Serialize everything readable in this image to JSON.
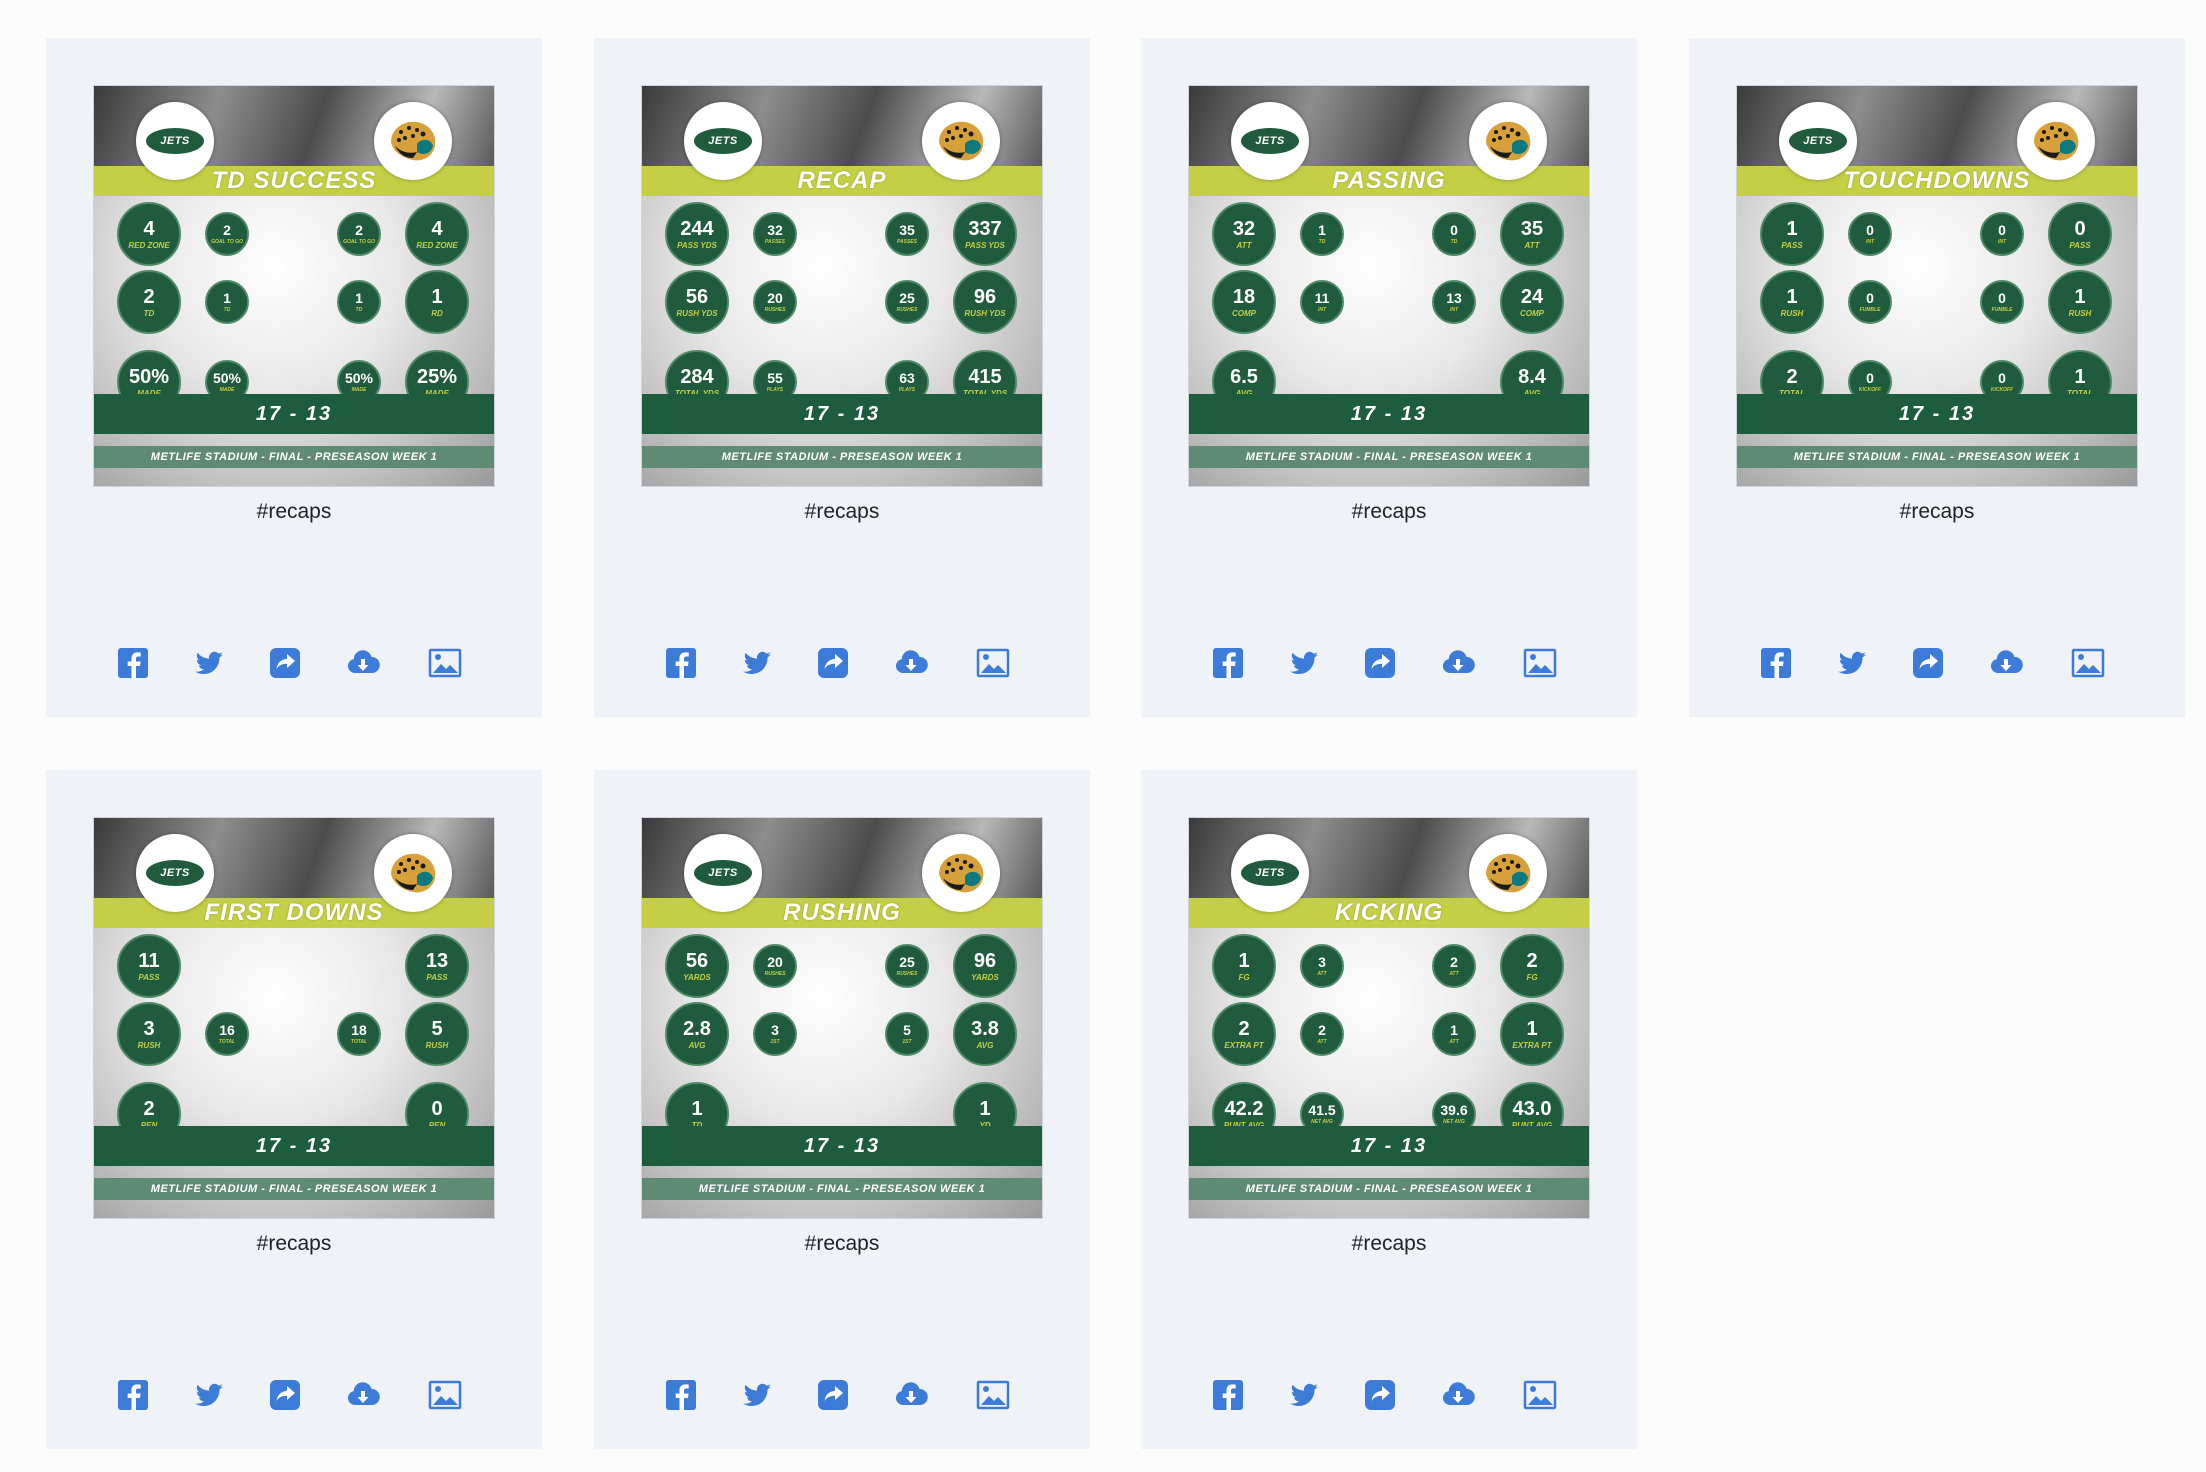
{
  "score": "17 - 13",
  "caption_tag": "#recaps",
  "colors": {
    "jets_green": "#1d5c3c",
    "accent_lime": "#c5cf45",
    "action_blue": "#3d7bd9",
    "card_bg": "#eff2f6"
  },
  "jets_logo_text": "JETS",
  "share_icons": [
    "facebook-icon",
    "twitter-icon",
    "share-icon",
    "download-cloud-icon",
    "image-icon"
  ],
  "cards": [
    {
      "title": "TD SUCCESS",
      "footer": "METLIFE STADIUM - FINAL - PRESEASON WEEK 1",
      "stats": [
        {
          "v": "4",
          "l": "RED ZONE"
        },
        {
          "v": "2",
          "l": "GOAL TO GO"
        },
        {
          "v": "2",
          "l": "GOAL TO GO"
        },
        {
          "v": "4",
          "l": "RED ZONE"
        },
        {
          "v": "2",
          "l": "TD"
        },
        {
          "v": "1",
          "l": "TD"
        },
        {
          "v": "1",
          "l": "TD"
        },
        {
          "v": "1",
          "l": "RD"
        },
        {
          "v": "50%",
          "l": "MADE"
        },
        {
          "v": "50%",
          "l": "MADE"
        },
        {
          "v": "50%",
          "l": "MADE"
        },
        {
          "v": "25%",
          "l": "MADE"
        }
      ]
    },
    {
      "title": "RECAP",
      "footer": "METLIFE STADIUM - PRESEASON WEEK 1",
      "stats": [
        {
          "v": "244",
          "l": "PASS YDS"
        },
        {
          "v": "32",
          "l": "PASSES"
        },
        {
          "v": "35",
          "l": "PASSES"
        },
        {
          "v": "337",
          "l": "PASS YDS"
        },
        {
          "v": "56",
          "l": "RUSH YDS"
        },
        {
          "v": "20",
          "l": "RUSHES"
        },
        {
          "v": "25",
          "l": "RUSHES"
        },
        {
          "v": "96",
          "l": "RUSH YDS"
        },
        {
          "v": "284",
          "l": "TOTAL YDS"
        },
        {
          "v": "55",
          "l": "PLAYS"
        },
        {
          "v": "63",
          "l": "PLAYS"
        },
        {
          "v": "415",
          "l": "TOTAL YDS"
        }
      ]
    },
    {
      "title": "PASSING",
      "footer": "METLIFE STADIUM - FINAL - PRESEASON WEEK 1",
      "stats": [
        {
          "v": "32",
          "l": "ATT"
        },
        {
          "v": "1",
          "l": "TD"
        },
        {
          "v": "0",
          "l": "TD"
        },
        {
          "v": "35",
          "l": "ATT"
        },
        {
          "v": "18",
          "l": "COMP"
        },
        {
          "v": "11",
          "l": "INT"
        },
        {
          "v": "13",
          "l": "INT"
        },
        {
          "v": "24",
          "l": "COMP"
        },
        {
          "v": "6.5",
          "l": "AVG"
        },
        {
          "v": "",
          "l": ""
        },
        {
          "v": "",
          "l": ""
        },
        {
          "v": "8.4",
          "l": "AVG"
        }
      ]
    },
    {
      "title": "TOUCHDOWNS",
      "footer": "METLIFE STADIUM - FINAL - PRESEASON WEEK 1",
      "stats": [
        {
          "v": "1",
          "l": "PASS"
        },
        {
          "v": "0",
          "l": "INT"
        },
        {
          "v": "0",
          "l": "INT"
        },
        {
          "v": "0",
          "l": "PASS"
        },
        {
          "v": "1",
          "l": "RUSH"
        },
        {
          "v": "0",
          "l": "FUMBLE"
        },
        {
          "v": "0",
          "l": "FUMBLE"
        },
        {
          "v": "1",
          "l": "RUSH"
        },
        {
          "v": "2",
          "l": "TOTAL"
        },
        {
          "v": "0",
          "l": "KICKOFF"
        },
        {
          "v": "0",
          "l": "KICKOFF"
        },
        {
          "v": "1",
          "l": "TOTAL"
        }
      ]
    },
    {
      "title": "FIRST DOWNS",
      "footer": "METLIFE STADIUM - FINAL - PRESEASON WEEK 1",
      "stats": [
        {
          "v": "11",
          "l": "PASS"
        },
        {
          "v": "",
          "l": ""
        },
        {
          "v": "",
          "l": ""
        },
        {
          "v": "13",
          "l": "PASS"
        },
        {
          "v": "3",
          "l": "RUSH"
        },
        {
          "v": "16",
          "l": "TOTAL"
        },
        {
          "v": "18",
          "l": "TOTAL"
        },
        {
          "v": "5",
          "l": "RUSH"
        },
        {
          "v": "2",
          "l": "PEN"
        },
        {
          "v": "",
          "l": ""
        },
        {
          "v": "",
          "l": ""
        },
        {
          "v": "0",
          "l": "PEN"
        }
      ]
    },
    {
      "title": "RUSHING",
      "footer": "METLIFE STADIUM - FINAL - PRESEASON WEEK 1",
      "stats": [
        {
          "v": "56",
          "l": "YARDS"
        },
        {
          "v": "20",
          "l": "RUSHES"
        },
        {
          "v": "25",
          "l": "RUSHES"
        },
        {
          "v": "96",
          "l": "YARDS"
        },
        {
          "v": "2.8",
          "l": "AVG"
        },
        {
          "v": "3",
          "l": "1ST"
        },
        {
          "v": "5",
          "l": "1ST"
        },
        {
          "v": "3.8",
          "l": "AVG"
        },
        {
          "v": "1",
          "l": "TD"
        },
        {
          "v": "",
          "l": ""
        },
        {
          "v": "",
          "l": ""
        },
        {
          "v": "1",
          "l": "YD"
        }
      ]
    },
    {
      "title": "KICKING",
      "footer": "METLIFE STADIUM - FINAL - PRESEASON WEEK 1",
      "stats": [
        {
          "v": "1",
          "l": "FG"
        },
        {
          "v": "3",
          "l": "ATT"
        },
        {
          "v": "2",
          "l": "ATT"
        },
        {
          "v": "2",
          "l": "FG"
        },
        {
          "v": "2",
          "l": "EXTRA PT"
        },
        {
          "v": "2",
          "l": "ATT"
        },
        {
          "v": "1",
          "l": "ATT"
        },
        {
          "v": "1",
          "l": "EXTRA PT"
        },
        {
          "v": "42.2",
          "l": "PUNT AVG"
        },
        {
          "v": "41.5",
          "l": "NET AVG"
        },
        {
          "v": "39.6",
          "l": "NET AVG"
        },
        {
          "v": "43.0",
          "l": "PUNT AVG"
        }
      ]
    }
  ]
}
